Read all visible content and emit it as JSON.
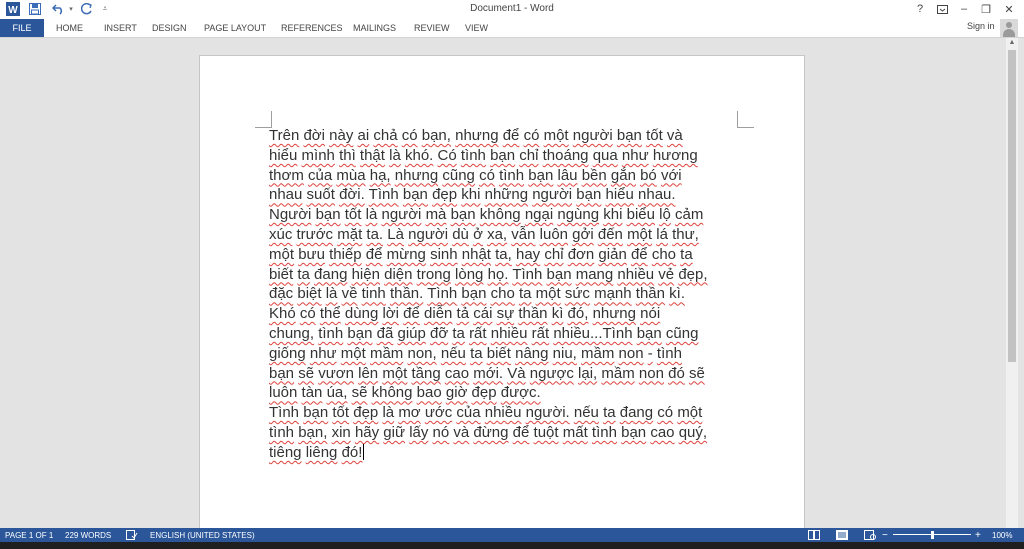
{
  "titlebar": {
    "title": "Document1 - Word",
    "word_icon": "word-app-icon",
    "save_icon": "save-icon",
    "undo_icon": "undo-icon",
    "redo_icon": "redo-icon",
    "customize_icon": "customize-quick-access-icon",
    "help": "?",
    "ribbon_display_icon": "ribbon-display-options-icon",
    "minimize": "–",
    "restore": "❐",
    "close": "✕"
  },
  "ribbon": {
    "tabs": [
      "FILE",
      "HOME",
      "INSERT",
      "DESIGN",
      "PAGE LAYOUT",
      "REFERENCES",
      "MAILINGS",
      "REVIEW",
      "VIEW"
    ],
    "sign_in": "Sign in"
  },
  "document": {
    "lines": [
      "Trên đời này ai chả có bạn, nhưng để có một người bạn tốt và",
      "hiểu mình thì thật là khó. Có tình bạn chỉ thoáng qua như hương",
      "thơm của mùa hạ, nhưng cũng có tình bạn lâu bền gắn bó với",
      "nhau suốt đời. Tình bạn đẹp khi những người bạn hiểu nhau.",
      "Người bạn tốt là người mà bạn không ngại ngùng khi biểu lộ cảm",
      "xúc trước mặt ta. Là người dù ở xa, vẫn luôn gởi đến một lá thư,",
      "một bưu thiếp để mừng sinh nhật ta, hay chỉ đơn giản để cho ta",
      "biết ta đang hiện diện trong lòng họ. Tình bạn mang nhiều vẻ đẹp,",
      "đặc biệt là về tinh thần. Tình bạn cho ta một sức mạnh thần kì.",
      "Khó có thể dùng lời để diễn tả cái sự thần kì đó, nhưng nói",
      "chung, tình bạn đã giúp đỡ ta rất nhiều rất nhiều...Tình bạn cũng",
      "giống như một mầm non, nếu ta biết nâng niu, mầm non - tình",
      "bạn sẽ vươn lên một tầng cao mới. Và ngược lại, mầm non đó sẽ",
      "luôn tàn úa, sẽ không bao giờ đẹp được.",
      "Tình bạn tốt đẹp là mơ ước của nhiều người. nếu ta đang có một",
      "tình bạn, xin hãy giữ lấy nó và đừng để tuột mất tình bạn cao quý,",
      "tiêng liêng đó!"
    ]
  },
  "statusbar": {
    "page": "PAGE 1 OF 1",
    "words": "229 WORDS",
    "proofing_icon": "proofing-icon",
    "language": "ENGLISH (UNITED STATES)",
    "read_mode_icon": "read-mode-icon",
    "print_layout_icon": "print-layout-icon",
    "web_layout_icon": "web-layout-icon",
    "zoom_out": "−",
    "zoom_in": "+",
    "zoom": "100%",
    "zoom_level": 1.0
  },
  "colors": {
    "accent": "#2b579a",
    "spellcheck": "#e0413c",
    "workspace": "#e3e3e3"
  }
}
